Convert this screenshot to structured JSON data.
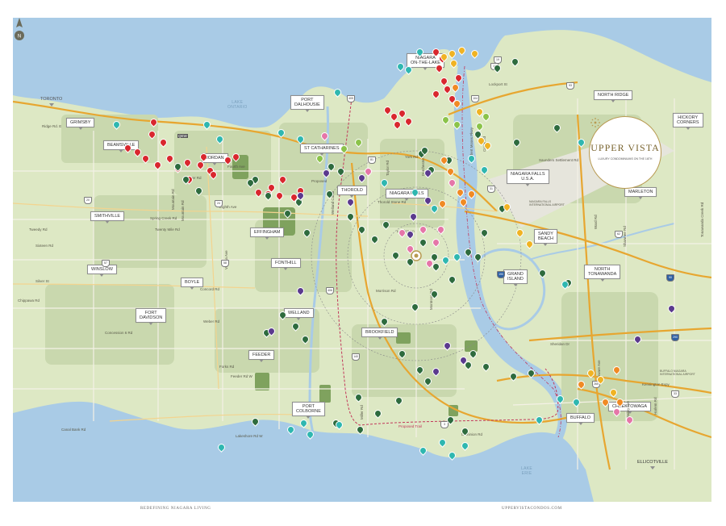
{
  "brand": {
    "name": "UPPER VISTA",
    "tagline": "LUXURY CONDOMINIUMS ON THE 16TH",
    "accent_color": "#b89a52"
  },
  "footer": {
    "left": "REDEFINING NIAGARA LIVING",
    "right": "UPPERVISTACONDOS.COM"
  },
  "colors": {
    "water": "#a9cbe6",
    "land": "#dde8c4",
    "urban": "#c9d8ae",
    "forest": "#7fa25e",
    "highway": "#e7a630",
    "local_road": "#f4f1e6",
    "border": "#c2375a",
    "pin_red": "#d9272e",
    "pin_green": "#2e6b3e",
    "pin_teal": "#2fb7b0",
    "pin_yellow": "#f0b323",
    "pin_orange": "#f08a24",
    "pin_purple": "#5b3a8e",
    "pin_pink": "#e576a8",
    "pin_lime": "#8bc34a"
  },
  "map": {
    "town_labels": [
      {
        "name": "TORONTO",
        "arrow": "left"
      },
      {
        "name": "GRIMSBY"
      },
      {
        "name": "BEAMSVILLE"
      },
      {
        "name": "JORDAN"
      },
      {
        "name": "PORT\nDALHOUSIE"
      },
      {
        "name": "ST CATHARINES"
      },
      {
        "name": "NIAGARA\nON-THE-LAKE"
      },
      {
        "name": "THOROLD"
      },
      {
        "name": "NIAGARA FALLS"
      },
      {
        "name": "NIAGARA FALLS\nU.S.A."
      },
      {
        "name": "SMITHVILLE"
      },
      {
        "name": "EFFINGHAM"
      },
      {
        "name": "FONTHILL"
      },
      {
        "name": "BOYLE"
      },
      {
        "name": "WINSLOW"
      },
      {
        "name": "FORT\nDAVIDSON"
      },
      {
        "name": "WELLAND"
      },
      {
        "name": "BROOKFIELD"
      },
      {
        "name": "FEEDER"
      },
      {
        "name": "PORT\nCOLBORNE"
      },
      {
        "name": "NORTH RIDGE"
      },
      {
        "name": "HICKORY\nCORNERS"
      },
      {
        "name": "MARLETON"
      },
      {
        "name": "SANDY\nBEACH"
      },
      {
        "name": "NORTH\nTONAWANDA"
      },
      {
        "name": "GRAND\nISLAND"
      },
      {
        "name": "BUFFALO"
      },
      {
        "name": "CHEEKTOWAGA"
      },
      {
        "name": "ELLICOTVILLE"
      }
    ],
    "water_labels": [
      "LAKE\nONTARIO",
      "LAKE\nERIE"
    ],
    "road_labels": [
      "Ridge Rd. E",
      "Mountain Rd",
      "Spring Creek Rd",
      "Twenty Mile Rd",
      "Mountain Rd",
      "Fourth Ave",
      "Eighth Ave",
      "Moyer Rd",
      "Victoria Ave",
      "Tweedy Rd",
      "Sixteen Rd",
      "Silver St",
      "Chippawa Rd",
      "Concord Rd",
      "Weber Rd",
      "Concession 6 Rd",
      "Forks Rd",
      "Feeder Rd W",
      "Canal Bank Rd",
      "Lakeshore Rd W",
      "Dominion Rd",
      "Miller Rd",
      "Morrison Rd",
      "Montrose Rd",
      "Thorold Stone Rd",
      "Taylor Rd",
      "Lundy's Ln",
      "York Rd",
      "Dorchester Rd",
      "Robert Moses Pkwy",
      "Creek Rd",
      "Saunders Settlement Rd",
      "Sheridan Dr",
      "Kensington Expy",
      "Delaware Ave",
      "Bailey Ave",
      "Harlem Rd",
      "Ward Rd",
      "Shawnee Rd",
      "Tonawanda Creek Rd",
      "Lockport St",
      "NIAGARA FALLS INTERNATIONAL AIRPORT",
      "BUFFALO NIAGARA INTERNATIONAL AIRPORT",
      "QEW",
      "Proposed",
      "Welland Canal",
      "Proposed Trail"
    ],
    "highway_shields": [
      "405",
      "406",
      "20",
      "58",
      "57",
      "3",
      "140",
      "81",
      "24",
      "190",
      "290",
      "90",
      "33",
      "62",
      "31",
      "93",
      "104",
      "18",
      "19",
      "265"
    ]
  }
}
